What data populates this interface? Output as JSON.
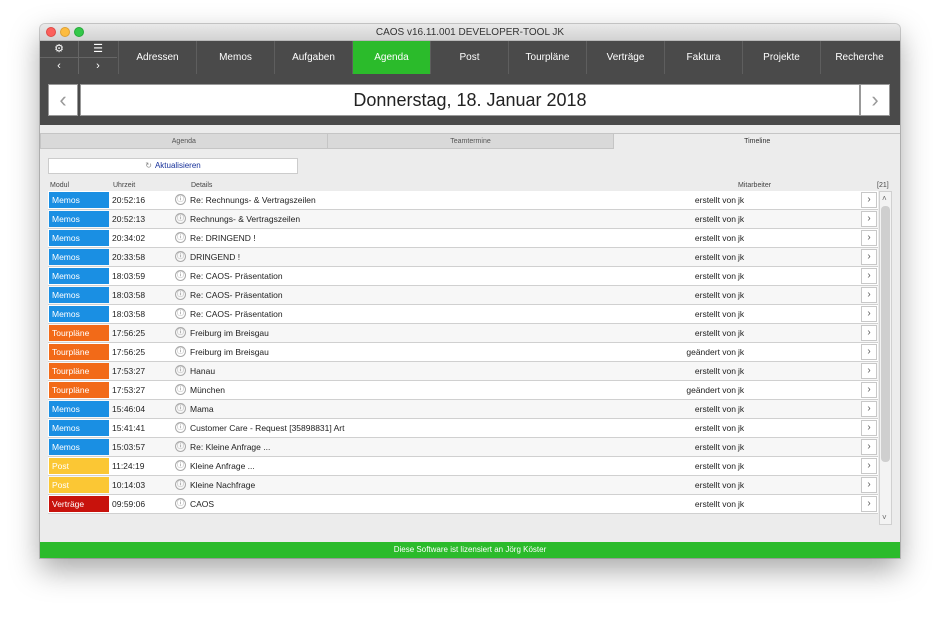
{
  "window": {
    "title": "CAOS v16.11.001  DEVELOPER-TOOL JK"
  },
  "controls": {
    "settings": "⚙",
    "menu": "☰",
    "prev": "‹",
    "next": "›"
  },
  "nav": {
    "tabs": [
      "Adressen",
      "Memos",
      "Aufgaben",
      "Agenda",
      "Post",
      "Tourpläne",
      "Verträge",
      "Faktura",
      "Projekte",
      "Recherche"
    ],
    "active": "Agenda",
    "active_color": "#2bbb2b"
  },
  "date": {
    "label": "Donnerstag, 18. Januar 2018",
    "prev": "‹",
    "next": "›"
  },
  "subtabs": [
    "Agenda",
    "Teamtermine",
    "Timeline"
  ],
  "refresh": {
    "label": "Aktualisieren",
    "icon": "refresh-icon"
  },
  "columns": {
    "module": "Modul",
    "time": "Uhrzeit",
    "details": "Details",
    "employee": "Mitarbeiter",
    "count": "[21]"
  },
  "module_colors": {
    "Memos": "#1a8fe3",
    "Tourpläne": "#f26a18",
    "Post": "#fbc734",
    "Verträge": "#c8120c"
  },
  "rows": [
    {
      "module": "Memos",
      "time": "20:52:16",
      "details": "Re: Rechnungs- & Vertragszeilen",
      "action": "erstellt von",
      "employee": "jk"
    },
    {
      "module": "Memos",
      "time": "20:52:13",
      "details": "Rechnungs- & Vertragszeilen",
      "action": "erstellt von",
      "employee": "jk"
    },
    {
      "module": "Memos",
      "time": "20:34:02",
      "details": "Re: DRINGEND !",
      "action": "erstellt von",
      "employee": "jk"
    },
    {
      "module": "Memos",
      "time": "20:33:58",
      "details": "DRINGEND !",
      "action": "erstellt von",
      "employee": "jk"
    },
    {
      "module": "Memos",
      "time": "18:03:59",
      "details": "Re: CAOS- Präsentation",
      "action": "erstellt von",
      "employee": "jk"
    },
    {
      "module": "Memos",
      "time": "18:03:58",
      "details": "Re: CAOS- Präsentation",
      "action": "erstellt von",
      "employee": "jk"
    },
    {
      "module": "Memos",
      "time": "18:03:58",
      "details": "Re: CAOS- Präsentation",
      "action": "erstellt von",
      "employee": "jk"
    },
    {
      "module": "Tourpläne",
      "time": "17:56:25",
      "details": "Freiburg im Breisgau",
      "action": "erstellt von",
      "employee": "jk"
    },
    {
      "module": "Tourpläne",
      "time": "17:56:25",
      "details": "Freiburg im Breisgau",
      "action": "geändert von",
      "employee": "jk"
    },
    {
      "module": "Tourpläne",
      "time": "17:53:27",
      "details": "Hanau",
      "action": "erstellt von",
      "employee": "jk"
    },
    {
      "module": "Tourpläne",
      "time": "17:53:27",
      "details": "München",
      "action": "geändert von",
      "employee": "jk"
    },
    {
      "module": "Memos",
      "time": "15:46:04",
      "details": "Mama",
      "action": "erstellt von",
      "employee": "jk"
    },
    {
      "module": "Memos",
      "time": "15:41:41",
      "details": "Customer Care - Request [35898831] Art",
      "action": "erstellt von",
      "employee": "jk"
    },
    {
      "module": "Memos",
      "time": "15:03:57",
      "details": "Re: Kleine Anfrage ...",
      "action": "erstellt von",
      "employee": "jk"
    },
    {
      "module": "Post",
      "time": "11:24:19",
      "details": "Kleine Anfrage ...",
      "action": "erstellt von",
      "employee": "jk"
    },
    {
      "module": "Post",
      "time": "10:14:03",
      "details": "Kleine Nachfrage",
      "action": "erstellt von",
      "employee": "jk"
    },
    {
      "module": "Verträge",
      "time": "09:59:06",
      "details": "CAOS",
      "action": "erstellt von",
      "employee": "jk"
    }
  ],
  "row_info_icon": "ⓘ",
  "row_button": "›",
  "scroll": {
    "up": "˄",
    "down": "˅"
  },
  "footer": {
    "text": "Diese Software ist lizensiert an Jörg Köster"
  }
}
